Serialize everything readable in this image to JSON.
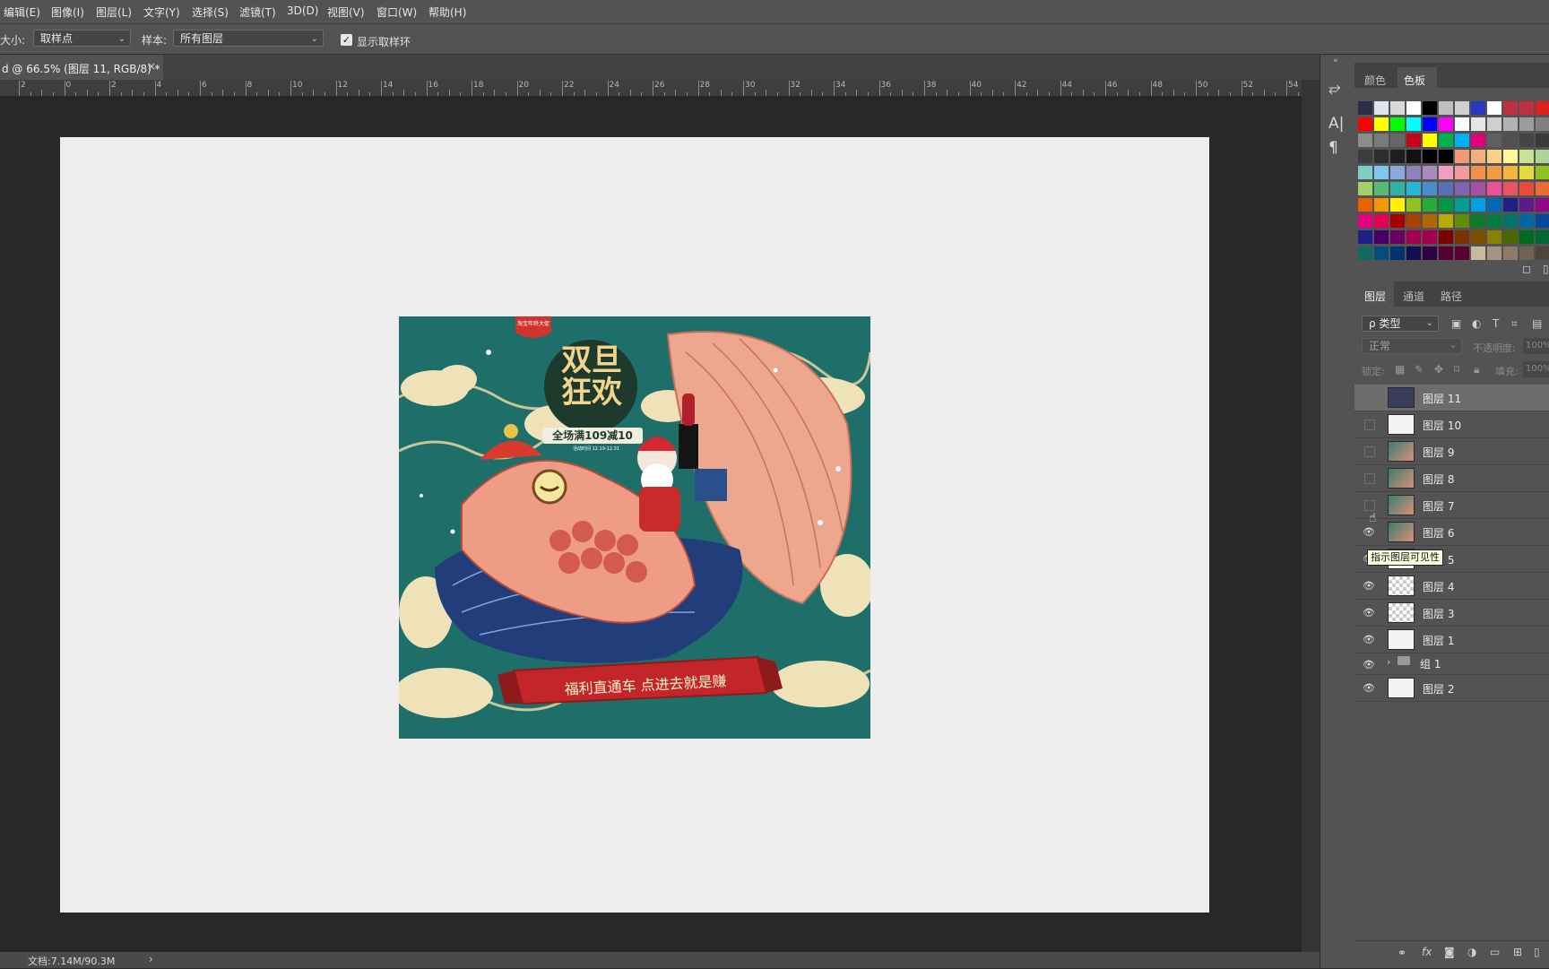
{
  "menu": [
    "编辑(E)",
    "图像(I)",
    "图层(L)",
    "文字(Y)",
    "选择(S)",
    "滤镜(T)",
    "3D(D)",
    "视图(V)",
    "窗口(W)",
    "帮助(H)"
  ],
  "options": {
    "size_label": "大小:",
    "size_value": "取样点",
    "sample_label": "样本:",
    "sample_value": "所有图层",
    "show_ring_checked": true,
    "show_ring_label": "显示取样环"
  },
  "document_tab": {
    "title": "d @ 66.5% (图层 11, RGB/8) *",
    "close": "×"
  },
  "ruler_labels": [
    "2",
    "0",
    "2",
    "4",
    "6",
    "8",
    "10",
    "12",
    "14",
    "16",
    "18",
    "20",
    "22",
    "24",
    "26",
    "28",
    "30",
    "32",
    "34",
    "36",
    "38",
    "40",
    "42",
    "44",
    "46",
    "48",
    "50",
    "52",
    "54"
  ],
  "poster": {
    "badge": "淘宝年终大促",
    "title_line1": "双旦",
    "title_line2": "狂欢",
    "subtitle": "全场满109减10",
    "date": "活动时间 12.19-12.31",
    "banner": "福利直通车 点进去就是赚"
  },
  "status": {
    "doc": "文档:7.14M/90.3M",
    "arrow": "›"
  },
  "icon_strip": [
    {
      "icon": "history-icon",
      "glyph": "⥂"
    },
    {
      "icon": "character-icon",
      "glyph": "A|"
    },
    {
      "icon": "paragraph-icon",
      "glyph": "¶"
    }
  ],
  "color_panel": {
    "tabs": [
      "颜色",
      "色板"
    ],
    "active_tab": "色板",
    "swatch_rows": [
      [
        "#2a2e4a",
        "#e0e4ee",
        "#d8d8d8",
        "#ffffff",
        "#000000",
        "#bfbfbf",
        "#d0d0d0",
        "#2838c0",
        "#ffffff",
        "#c03040",
        "#c03040",
        "#e02020"
      ],
      [
        "#ff0000",
        "#ffff00",
        "#00ff00",
        "#00ffff",
        "#0000ff",
        "#ff00ff",
        "#ffffff",
        "#e6e6e6",
        "#cfcfcf",
        "#b3b3b3",
        "#9c9c9c",
        "#808080"
      ],
      [
        "#8c8c8c",
        "#7a7a7a",
        "#666666",
        "#c8001e",
        "#ffff00",
        "#00b050",
        "#00b0f0",
        "#e0007a",
        "#606060",
        "#505050",
        "#454545",
        "#3a3a3a"
      ],
      [
        "#3d3d3d",
        "#2e2e2e",
        "#1e1e1e",
        "#111111",
        "#000000",
        "#000000",
        "#f29a76",
        "#f5b07a",
        "#fad089",
        "#fff799",
        "#cce198",
        "#acd598"
      ],
      [
        "#7ecdc7",
        "#80c7ee",
        "#88abda",
        "#8f82bc",
        "#aa89bd",
        "#f19ec2",
        "#f29b9b",
        "#f19149",
        "#f39a44",
        "#f5b33f",
        "#e3d83c",
        "#8fc31f"
      ],
      [
        "#a5d16d",
        "#5bb976",
        "#31b3a1",
        "#25b6d2",
        "#4a8ecf",
        "#5b6fb7",
        "#7f65b0",
        "#a152a2",
        "#e9529a",
        "#e95464",
        "#e94b3c",
        "#ea6b35"
      ],
      [
        "#eb6100",
        "#f39800",
        "#fff100",
        "#8fc31f",
        "#22ac38",
        "#009944",
        "#009e96",
        "#00a0e9",
        "#0068b7",
        "#1d2088",
        "#601986",
        "#920783"
      ],
      [
        "#e4007f",
        "#e5004f",
        "#a40000",
        "#a84200",
        "#ac6a00",
        "#b7aa00",
        "#638c0b",
        "#097c25",
        "#007b43",
        "#00736d",
        "#0066a6",
        "#00479d"
      ],
      [
        "#1d2088",
        "#440062",
        "#6a005f",
        "#a20057",
        "#a4004f",
        "#7d0000",
        "#7e3100",
        "#7f4f00",
        "#897f00",
        "#4a6a00",
        "#006b1d",
        "#006835"
      ],
      [
        "#0e6b5e",
        "#004e7c",
        "#003471",
        "#110f50",
        "#2e0046",
        "#520036",
        "#5d0030",
        "#c8b9a0",
        "#a59483",
        "#8c7b6b",
        "#6f6153",
        "#4e4438"
      ]
    ]
  },
  "layers_panel": {
    "tabs": [
      "图层",
      "通道",
      "路径"
    ],
    "active_tab": "图层",
    "filter_label": "ρ 类型",
    "blend_mode": "正常",
    "opacity_label": "不透明度:",
    "opacity_value": "100%",
    "lock_label": "锁定:",
    "fill_label": "填充:",
    "fill_value": "100%",
    "tooltip": "指示图层可见性",
    "layers": [
      {
        "name": "图层 11",
        "visible": false,
        "selected": true,
        "thumb": "dark"
      },
      {
        "name": "图层 10",
        "visible": false,
        "selected": false,
        "thumb": "light"
      },
      {
        "name": "图层 9",
        "visible": false,
        "selected": false,
        "thumb": "img"
      },
      {
        "name": "图层 8",
        "visible": false,
        "selected": false,
        "thumb": "img"
      },
      {
        "name": "图层 7",
        "visible": false,
        "selected": false,
        "thumb": "img"
      },
      {
        "name": "图层 6",
        "visible": true,
        "selected": false,
        "thumb": "img"
      },
      {
        "name": "图层 5",
        "visible": true,
        "selected": false,
        "thumb": "light"
      },
      {
        "name": "图层 4",
        "visible": true,
        "selected": false,
        "thumb": "checker"
      },
      {
        "name": "图层 3",
        "visible": true,
        "selected": false,
        "thumb": "checker"
      },
      {
        "name": "图层 1",
        "visible": true,
        "selected": false,
        "thumb": "light"
      },
      {
        "name": "组 1",
        "visible": true,
        "selected": false,
        "thumb": "folder"
      },
      {
        "name": "图层 2",
        "visible": true,
        "selected": false,
        "thumb": "light"
      }
    ],
    "footer_icons": [
      "link-icon",
      "fx-icon",
      "mask-icon",
      "adjustment-icon",
      "folder-icon",
      "new-layer-icon",
      "trash-icon"
    ]
  }
}
